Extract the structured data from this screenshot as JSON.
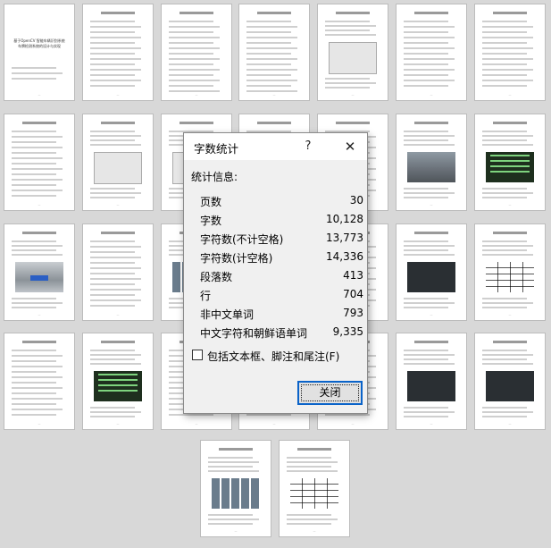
{
  "dialog": {
    "title": "字数统计",
    "help_label": "?",
    "close_label": "✕",
    "section_label": "统计信息:",
    "stats": [
      {
        "label": "页数",
        "value": "30"
      },
      {
        "label": "字数",
        "value": "10,128"
      },
      {
        "label": "字符数(不计空格)",
        "value": "13,773"
      },
      {
        "label": "字符数(计空格)",
        "value": "14,336"
      },
      {
        "label": "段落数",
        "value": "413"
      },
      {
        "label": "行",
        "value": "704"
      },
      {
        "label": "非中文单词",
        "value": "793"
      },
      {
        "label": "中文字符和朝鲜语单词",
        "value": "9,335"
      }
    ],
    "checkbox_label": "包括文本框、脚注和尾注(F)",
    "checkbox_checked": false,
    "close_button_label": "关闭"
  },
  "thumbnails": {
    "cover_text": "基于OpenCV 智能车辆识别系统\n车牌检测系统的设计与实现"
  }
}
